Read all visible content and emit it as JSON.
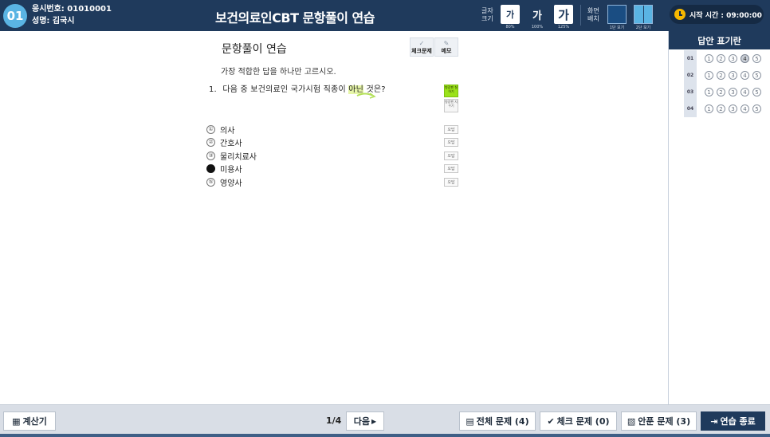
{
  "header": {
    "badge": "01",
    "exam_number": "응시번호: 01010001",
    "name": "성명: 김국시",
    "title": "보건의료인CBT 문항풀이 연습",
    "font_size": {
      "label_line1": "글자",
      "label_line2": "크기",
      "small": "가",
      "small_pct": "80%",
      "medium": "가",
      "medium_pct": "100%",
      "large": "가",
      "large_pct": "125%"
    },
    "layout": {
      "label_line1": "화면",
      "label_line2": "배치",
      "one_col": "1단 보기",
      "two_col": "2단 보기"
    },
    "start_time": "시작 시간 : 09:00:00"
  },
  "question": {
    "section_title": "문항풀이 연습",
    "check_label": "체크문제",
    "memo_label": "메모",
    "instruction": "가장 적합한 답을 하나만 고르시오.",
    "number": "1.",
    "text_before": "다음 중 보건의료인 국가시험 직종이 ",
    "text_highlight": "아닌",
    "text_after": " 것은?",
    "tag_mark": "형광펜 칠하기",
    "tag_clear": "형광펜 지우기",
    "selected_option": 4,
    "options": [
      {
        "num": "①",
        "label": "의사",
        "tag": "오답"
      },
      {
        "num": "②",
        "label": "간호사",
        "tag": "오답"
      },
      {
        "num": "③",
        "label": "물리치료사",
        "tag": "오답"
      },
      {
        "num": "④",
        "label": "미용사",
        "tag": "오답"
      },
      {
        "num": "⑤",
        "label": "영양사",
        "tag": "오답"
      }
    ]
  },
  "answer_sheet": {
    "title": "답안 표기란",
    "rows": [
      {
        "num": "01",
        "selected": 4
      },
      {
        "num": "02",
        "selected": 0
      },
      {
        "num": "03",
        "selected": 0
      },
      {
        "num": "04",
        "selected": 0
      }
    ],
    "choices": [
      "1",
      "2",
      "3",
      "4",
      "5"
    ]
  },
  "footer": {
    "calculator": "계산기",
    "page": "1/4",
    "next": "다음",
    "all_questions": "전체 문제 (4)",
    "checked_questions": "체크 문제 (0)",
    "unanswered_questions": "안푼 문제 (3)",
    "end_practice": "연습 종료"
  },
  "colors": {
    "header_bg": "#1f3a5c",
    "badge": "#5ab4e3",
    "highlight_green": "#9be21a",
    "footer_bg": "#d9dee6"
  },
  "icons": {
    "calculator": "calculator-icon",
    "next": "caret-right-icon",
    "all": "document-icon",
    "check": "check-icon",
    "unanswered": "document-x-icon",
    "exit": "exit-icon",
    "clock": "clock-icon",
    "memo": "pencil-icon"
  }
}
